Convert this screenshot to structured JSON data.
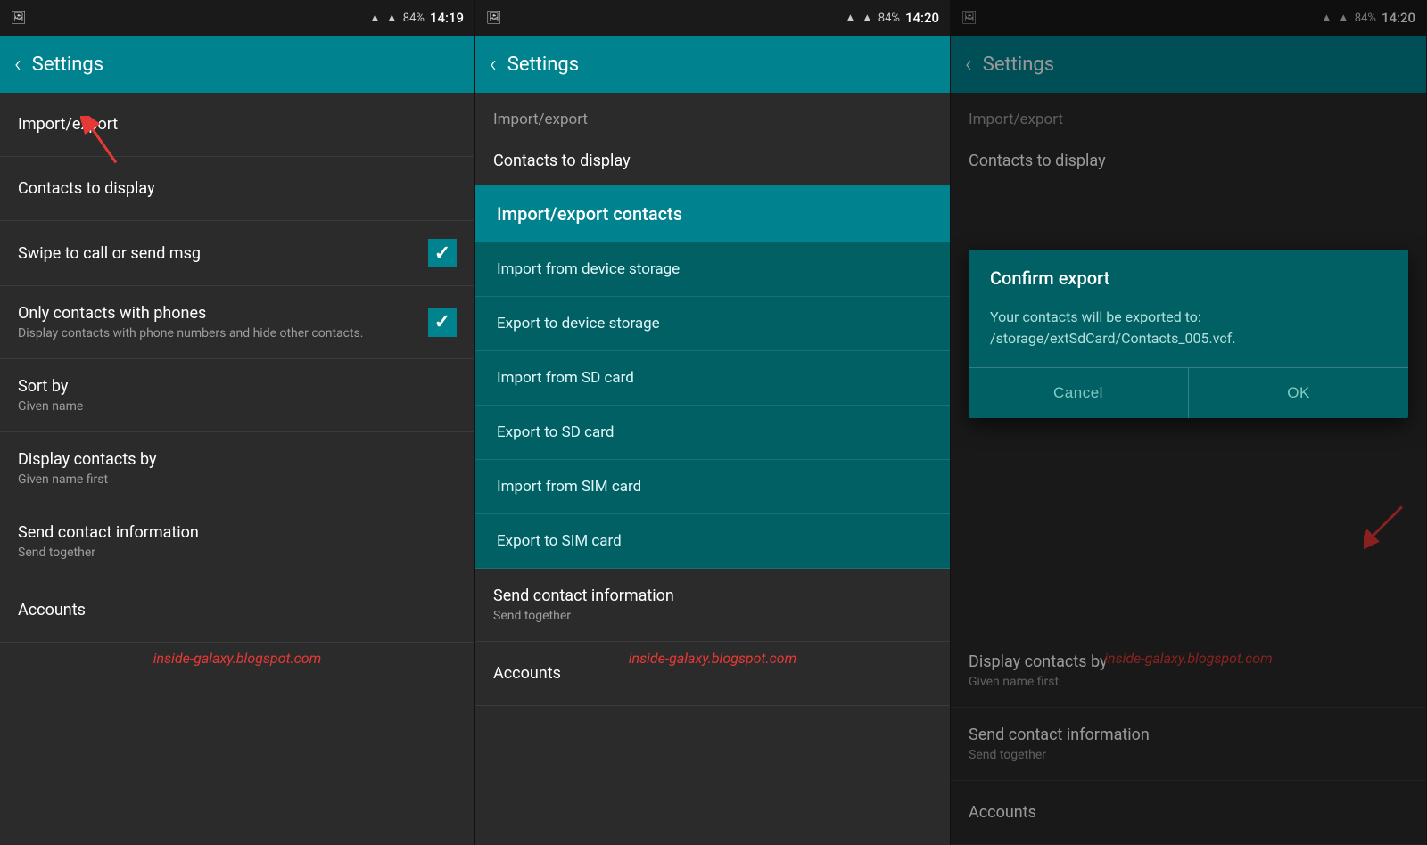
{
  "panels": [
    {
      "id": "panel1",
      "status": {
        "left_icon": "📷",
        "signal_icons": "▲▲",
        "wifi": "wifi",
        "battery": "84%",
        "time": "14:19"
      },
      "toolbar": {
        "back_label": "‹",
        "title": "Settings"
      },
      "section": "Import/export",
      "items": [
        {
          "title": "Import/export",
          "subtitle": "",
          "checkbox": false
        },
        {
          "title": "Contacts to display",
          "subtitle": "",
          "checkbox": false
        },
        {
          "title": "Swipe to call or send msg",
          "subtitle": "",
          "checkbox": true,
          "checked": true
        },
        {
          "title": "Only contacts with phones",
          "subtitle": "Display contacts with phone numbers and hide other contacts.",
          "checkbox": true,
          "checked": true
        },
        {
          "title": "Sort by",
          "subtitle": "Given name",
          "checkbox": false
        },
        {
          "title": "Display contacts by",
          "subtitle": "Given name first",
          "checkbox": false
        },
        {
          "title": "Send contact information",
          "subtitle": "Send together",
          "checkbox": false
        },
        {
          "title": "Accounts",
          "subtitle": "",
          "checkbox": false
        }
      ],
      "watermark": "inside-galaxy.blogspot.com"
    },
    {
      "id": "panel2",
      "status": {
        "time": "14:20"
      },
      "toolbar": {
        "back_label": "‹",
        "title": "Settings"
      },
      "section": "Import/export",
      "background_items": [
        {
          "title": "Import/export",
          "subtitle": ""
        },
        {
          "title": "Contacts to display",
          "subtitle": ""
        }
      ],
      "dialog": {
        "header": "Import/export contacts",
        "items": [
          "Import from device storage",
          "Export to device storage",
          "Import from SD card",
          "Export to SD card",
          "Import from SIM card",
          "Export to SIM card"
        ]
      },
      "bottom_items": [
        {
          "title": "Send contact information",
          "subtitle": "Send together"
        },
        {
          "title": "Accounts",
          "subtitle": ""
        }
      ],
      "watermark": "inside-galaxy.blogspot.com"
    },
    {
      "id": "panel3",
      "status": {
        "time": "14:20"
      },
      "toolbar": {
        "back_label": "‹",
        "title": "Settings"
      },
      "section": "Import/export",
      "background_items": [
        {
          "title": "Import/export",
          "subtitle": ""
        },
        {
          "title": "Contacts to display",
          "subtitle": ""
        }
      ],
      "confirm_dialog": {
        "title": "Confirm export",
        "body": "Your contacts will be exported to: /storage/extSdCard/Contacts_005.vcf.",
        "cancel_label": "Cancel",
        "ok_label": "OK"
      },
      "bottom_items": [
        {
          "title": "Display contacts by",
          "subtitle": "Given name first"
        },
        {
          "title": "Send contact information",
          "subtitle": "Send together"
        },
        {
          "title": "Accounts",
          "subtitle": ""
        }
      ],
      "watermark": "inside-galaxy.blogspot.com"
    }
  ]
}
